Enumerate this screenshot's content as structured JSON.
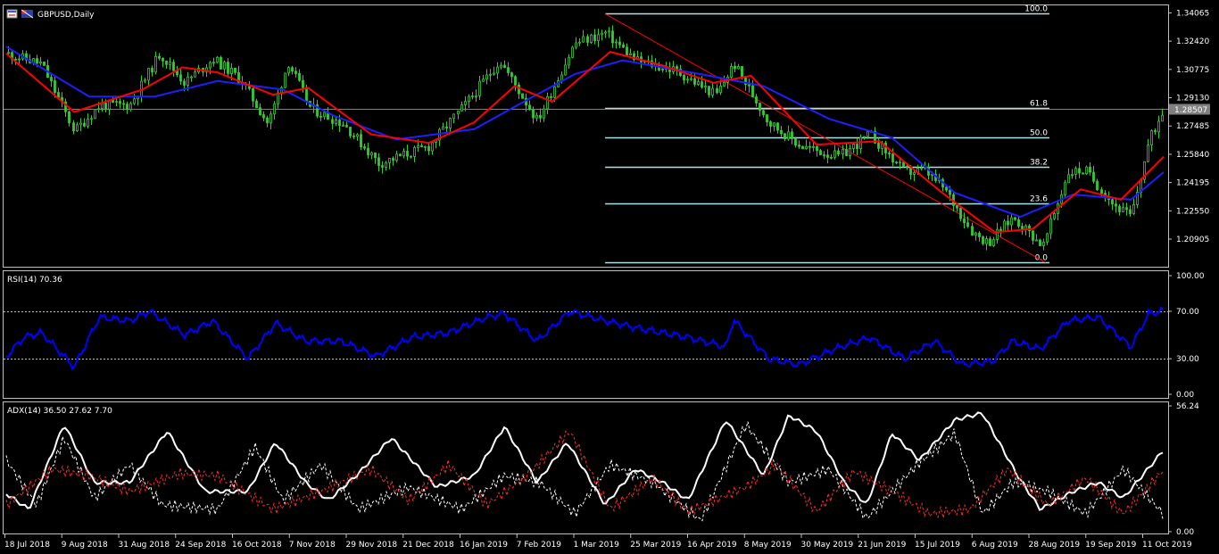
{
  "chart_title": "GBPUSD,Daily",
  "colors": {
    "background": "#000000",
    "frame": "#c0c0c0",
    "candle": "#32cd32",
    "ma_fast": "#ff0000",
    "ma_slow": "#1e1eff",
    "fib": "#b0e0e6",
    "trendline": "#ff0000",
    "rsi": "#0000ff",
    "adx_main": "#ffffff",
    "plus_di": "#ffffff",
    "minus_di": "#ff2a2a",
    "current_price_bg": "#808080"
  },
  "icons": [
    "chart-window-icon",
    "flag-icon"
  ],
  "chart_data": [
    {
      "type": "candlestick",
      "symbol": "GBPUSD",
      "timeframe": "Daily",
      "title": "GBPUSD,Daily",
      "ylim": [
        1.1935,
        1.3445
      ],
      "y_ticks": [
        "1.34065",
        "1.32420",
        "1.30775",
        "1.29130",
        "1.27485",
        "1.25840",
        "1.24195",
        "1.22550",
        "1.20905"
      ],
      "current_price": "1.28507",
      "close_path": [
        [
          "2018-07-18",
          1.317
        ],
        [
          "2018-08-01",
          1.311
        ],
        [
          "2018-08-14",
          1.272
        ],
        [
          "2018-08-24",
          1.287
        ],
        [
          "2018-09-05",
          1.287
        ],
        [
          "2018-09-17",
          1.317
        ],
        [
          "2018-09-27",
          1.3
        ],
        [
          "2018-10-08",
          1.314
        ],
        [
          "2018-10-19",
          1.302
        ],
        [
          "2018-10-30",
          1.276
        ],
        [
          "2018-11-07",
          1.312
        ],
        [
          "2018-11-16",
          1.285
        ],
        [
          "2018-11-29",
          1.276
        ],
        [
          "2018-12-13",
          1.253
        ],
        [
          "2019-01-02",
          1.263
        ],
        [
          "2019-01-16",
          1.287
        ],
        [
          "2019-01-30",
          1.313
        ],
        [
          "2019-02-14",
          1.278
        ],
        [
          "2019-03-01",
          1.323
        ],
        [
          "2019-03-13",
          1.329
        ],
        [
          "2019-03-25",
          1.313
        ],
        [
          "2019-04-10",
          1.307
        ],
        [
          "2019-04-26",
          1.293
        ],
        [
          "2019-05-03",
          1.311
        ],
        [
          "2019-05-17",
          1.277
        ],
        [
          "2019-05-30",
          1.263
        ],
        [
          "2019-06-14",
          1.257
        ],
        [
          "2019-06-26",
          1.27
        ],
        [
          "2019-07-10",
          1.248
        ],
        [
          "2019-07-18",
          1.249
        ],
        [
          "2019-07-26",
          1.238
        ],
        [
          "2019-08-06",
          1.213
        ],
        [
          "2019-08-12",
          1.207
        ],
        [
          "2019-08-22",
          1.222
        ],
        [
          "2019-09-03",
          1.205
        ],
        [
          "2019-09-13",
          1.248
        ],
        [
          "2019-09-20",
          1.249
        ],
        [
          "2019-10-01",
          1.229
        ],
        [
          "2019-10-08",
          1.222
        ],
        [
          "2019-10-15",
          1.266
        ],
        [
          "2019-10-21",
          1.285
        ]
      ],
      "ma_fast_path": [
        [
          "2018-07-18",
          1.317
        ],
        [
          "2018-08-14",
          1.283
        ],
        [
          "2018-09-10",
          1.296
        ],
        [
          "2018-09-26",
          1.309
        ],
        [
          "2018-10-10",
          1.306
        ],
        [
          "2018-11-01",
          1.293
        ],
        [
          "2018-11-15",
          1.297
        ],
        [
          "2018-12-10",
          1.27
        ],
        [
          "2019-01-02",
          1.265
        ],
        [
          "2019-01-20",
          1.277
        ],
        [
          "2019-02-05",
          1.298
        ],
        [
          "2019-02-20",
          1.289
        ],
        [
          "2019-03-15",
          1.318
        ],
        [
          "2019-04-05",
          1.31
        ],
        [
          "2019-04-25",
          1.3
        ],
        [
          "2019-05-10",
          1.304
        ],
        [
          "2019-06-05",
          1.264
        ],
        [
          "2019-06-30",
          1.266
        ],
        [
          "2019-07-25",
          1.236
        ],
        [
          "2019-08-15",
          1.213
        ],
        [
          "2019-08-30",
          1.215
        ],
        [
          "2019-09-18",
          1.238
        ],
        [
          "2019-10-04",
          1.232
        ],
        [
          "2019-10-21",
          1.257
        ]
      ],
      "ma_slow_path": [
        [
          "2018-07-18",
          1.321
        ],
        [
          "2018-08-20",
          1.292
        ],
        [
          "2018-09-15",
          1.292
        ],
        [
          "2018-10-10",
          1.301
        ],
        [
          "2018-11-05",
          1.296
        ],
        [
          "2018-11-25",
          1.281
        ],
        [
          "2018-12-20",
          1.267
        ],
        [
          "2019-01-20",
          1.273
        ],
        [
          "2019-02-10",
          1.29
        ],
        [
          "2019-03-01",
          1.305
        ],
        [
          "2019-03-20",
          1.313
        ],
        [
          "2019-04-20",
          1.305
        ],
        [
          "2019-05-15",
          1.298
        ],
        [
          "2019-06-10",
          1.279
        ],
        [
          "2019-07-05",
          1.268
        ],
        [
          "2019-07-30",
          1.236
        ],
        [
          "2019-08-25",
          1.222
        ],
        [
          "2019-09-15",
          1.235
        ],
        [
          "2019-10-08",
          1.232
        ],
        [
          "2019-10-21",
          1.248
        ]
      ],
      "fibonacci": {
        "levels": [
          {
            "label": "100.0",
            "price": 1.3401
          },
          {
            "label": "61.8",
            "price": 1.2852
          },
          {
            "label": "50.0",
            "price": 1.2681
          },
          {
            "label": "38.2",
            "price": 1.2509
          },
          {
            "label": "23.6",
            "price": 1.2297
          },
          {
            "label": "0.0",
            "price": 1.1955
          }
        ],
        "from_date": "2019-03-13",
        "to_date": "2019-09-04"
      },
      "trendline": {
        "from": [
          "2019-03-13",
          1.3401
        ],
        "to": [
          "2019-09-04",
          1.1955
        ]
      },
      "x_ticks": [
        "18 Jul 2018",
        "9 Aug 2018",
        "31 Aug 2018",
        "24 Sep 2018",
        "16 Oct 2018",
        "7 Nov 2018",
        "29 Nov 2018",
        "21 Dec 2018",
        "16 Jan 2019",
        "7 Feb 2019",
        "1 Mar 2019",
        "25 Mar 2019",
        "16 Apr 2019",
        "8 May 2019",
        "30 May 2019",
        "21 Jun 2019",
        "15 Jul 2019",
        "6 Aug 2019",
        "28 Aug 2019",
        "19 Sep 2019",
        "11 Oct 2019"
      ]
    },
    {
      "type": "line",
      "indicator": "RSI",
      "title": "RSI(14) 70.36",
      "ylim": [
        0,
        100
      ],
      "y_ticks": [
        "100.00",
        "70.00",
        "30.00",
        "0.00"
      ],
      "levels": [
        70,
        30
      ],
      "path": [
        [
          "2018-07-18",
          32
        ],
        [
          "2018-07-25",
          48
        ],
        [
          "2018-08-01",
          52
        ],
        [
          "2018-08-14",
          23
        ],
        [
          "2018-08-24",
          65
        ],
        [
          "2018-09-05",
          62
        ],
        [
          "2018-09-13",
          70
        ],
        [
          "2018-09-27",
          50
        ],
        [
          "2018-10-08",
          62
        ],
        [
          "2018-10-22",
          30
        ],
        [
          "2018-11-02",
          60
        ],
        [
          "2018-11-14",
          45
        ],
        [
          "2018-11-28",
          45
        ],
        [
          "2018-12-12",
          32
        ],
        [
          "2018-12-26",
          48
        ],
        [
          "2019-01-10",
          52
        ],
        [
          "2019-01-25",
          65
        ],
        [
          "2019-02-01",
          68
        ],
        [
          "2019-02-14",
          45
        ],
        [
          "2019-02-27",
          70
        ],
        [
          "2019-03-13",
          62
        ],
        [
          "2019-03-28",
          55
        ],
        [
          "2019-04-15",
          48
        ],
        [
          "2019-04-30",
          40
        ],
        [
          "2019-05-03",
          63
        ],
        [
          "2019-05-17",
          30
        ],
        [
          "2019-05-29",
          25
        ],
        [
          "2019-06-12",
          38
        ],
        [
          "2019-06-26",
          48
        ],
        [
          "2019-07-10",
          30
        ],
        [
          "2019-07-22",
          45
        ],
        [
          "2019-08-02",
          25
        ],
        [
          "2019-08-14",
          28
        ],
        [
          "2019-08-22",
          45
        ],
        [
          "2019-09-02",
          38
        ],
        [
          "2019-09-13",
          62
        ],
        [
          "2019-09-25",
          65
        ],
        [
          "2019-10-08",
          40
        ],
        [
          "2019-10-15",
          68
        ],
        [
          "2019-10-21",
          70.36
        ]
      ]
    },
    {
      "type": "line",
      "indicator": "ADX",
      "title": "ADX(14) 36.50 27.62 7.70",
      "ylim": [
        0,
        56.24
      ],
      "y_ticks": [
        "56.24",
        "0.00"
      ],
      "series": [
        {
          "name": "ADX",
          "path": [
            [
              "2018-07-18",
              17
            ],
            [
              "2018-07-27",
              10
            ],
            [
              "2018-08-10",
              48
            ],
            [
              "2018-08-22",
              22
            ],
            [
              "2018-09-05",
              22
            ],
            [
              "2018-09-20",
              45
            ],
            [
              "2018-10-05",
              18
            ],
            [
              "2018-10-22",
              18
            ],
            [
              "2018-11-02",
              40
            ],
            [
              "2018-11-14",
              22
            ],
            [
              "2018-11-23",
              14
            ],
            [
              "2018-12-05",
              26
            ],
            [
              "2018-12-18",
              42
            ],
            [
              "2019-01-05",
              20
            ],
            [
              "2019-01-20",
              25
            ],
            [
              "2019-02-01",
              47
            ],
            [
              "2019-02-14",
              22
            ],
            [
              "2019-02-26",
              40
            ],
            [
              "2019-03-13",
              12
            ],
            [
              "2019-03-25",
              28
            ],
            [
              "2019-04-05",
              22
            ],
            [
              "2019-04-15",
              14
            ],
            [
              "2019-04-30",
              50
            ],
            [
              "2019-05-15",
              25
            ],
            [
              "2019-05-25",
              52
            ],
            [
              "2019-06-05",
              45
            ],
            [
              "2019-06-16",
              22
            ],
            [
              "2019-06-25",
              12
            ],
            [
              "2019-07-05",
              44
            ],
            [
              "2019-07-16",
              32
            ],
            [
              "2019-07-30",
              50
            ],
            [
              "2019-08-10",
              53
            ],
            [
              "2019-08-24",
              25
            ],
            [
              "2019-09-02",
              10
            ],
            [
              "2019-09-15",
              18
            ],
            [
              "2019-09-25",
              22
            ],
            [
              "2019-10-05",
              15
            ],
            [
              "2019-10-21",
              36.5
            ]
          ]
        },
        {
          "name": "+DI",
          "path": [
            [
              "2018-07-18",
              32
            ],
            [
              "2018-07-30",
              12
            ],
            [
              "2018-08-10",
              42
            ],
            [
              "2018-08-22",
              15
            ],
            [
              "2018-09-05",
              30
            ],
            [
              "2018-09-18",
              12
            ],
            [
              "2018-10-10",
              10
            ],
            [
              "2018-10-25",
              38
            ],
            [
              "2018-11-05",
              14
            ],
            [
              "2018-11-20",
              30
            ],
            [
              "2018-12-05",
              10
            ],
            [
              "2018-12-25",
              20
            ],
            [
              "2019-01-15",
              10
            ],
            [
              "2019-02-01",
              25
            ],
            [
              "2019-02-15",
              22
            ],
            [
              "2019-03-01",
              8
            ],
            [
              "2019-03-15",
              30
            ],
            [
              "2019-04-01",
              22
            ],
            [
              "2019-04-20",
              5
            ],
            [
              "2019-05-08",
              48
            ],
            [
              "2019-05-25",
              22
            ],
            [
              "2019-06-10",
              28
            ],
            [
              "2019-06-25",
              6
            ],
            [
              "2019-07-15",
              30
            ],
            [
              "2019-07-30",
              44
            ],
            [
              "2019-08-10",
              8
            ],
            [
              "2019-08-22",
              22
            ],
            [
              "2019-09-05",
              18
            ],
            [
              "2019-09-20",
              8
            ],
            [
              "2019-10-05",
              28
            ],
            [
              "2019-10-21",
              7.7
            ]
          ]
        },
        {
          "name": "-DI",
          "path": [
            [
              "2018-07-18",
              12
            ],
            [
              "2018-08-05",
              28
            ],
            [
              "2018-08-20",
              25
            ],
            [
              "2018-09-05",
              18
            ],
            [
              "2018-09-25",
              26
            ],
            [
              "2018-10-10",
              25
            ],
            [
              "2018-11-01",
              10
            ],
            [
              "2018-11-20",
              18
            ],
            [
              "2018-12-10",
              28
            ],
            [
              "2018-12-25",
              14
            ],
            [
              "2019-01-10",
              30
            ],
            [
              "2019-01-25",
              12
            ],
            [
              "2019-02-10",
              25
            ],
            [
              "2019-02-27",
              45
            ],
            [
              "2019-03-15",
              10
            ],
            [
              "2019-04-01",
              24
            ],
            [
              "2019-04-15",
              9
            ],
            [
              "2019-05-08",
              20
            ],
            [
              "2019-05-20",
              30
            ],
            [
              "2019-06-05",
              9
            ],
            [
              "2019-06-20",
              27
            ],
            [
              "2019-07-05",
              18
            ],
            [
              "2019-07-20",
              8
            ],
            [
              "2019-08-05",
              10
            ],
            [
              "2019-08-20",
              28
            ],
            [
              "2019-09-05",
              12
            ],
            [
              "2019-09-20",
              24
            ],
            [
              "2019-10-05",
              8
            ],
            [
              "2019-10-21",
              27.62
            ]
          ]
        }
      ]
    }
  ]
}
